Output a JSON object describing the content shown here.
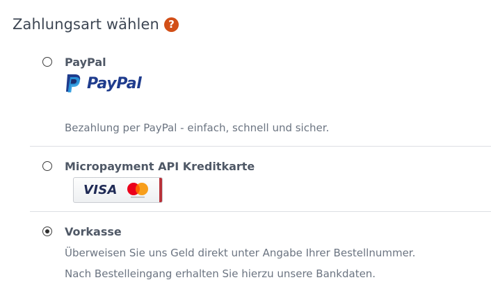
{
  "section": {
    "title": "Zahlungsart wählen",
    "help_icon": "question-circle-icon",
    "help_glyph": "?",
    "help_color": "#d24f17"
  },
  "payment_options": [
    {
      "label": "PayPal",
      "logo_text": "PayPal",
      "logo_icon": "paypal-logo-icon",
      "description": "Bezahlung per PayPal - einfach, schnell und sicher.",
      "selected": false
    },
    {
      "label": "Micropayment API Kreditkarte",
      "logo_text": "VISA",
      "logo_icon": "visa-mastercard-logo-icon",
      "selected": false
    },
    {
      "label": "Vorkasse",
      "description_lines": [
        "Überweisen Sie uns Geld direkt unter Angabe Ihrer Bestellnummer.",
        "Nach Bestelleingang erhalten Sie hierzu unsere Bankdaten."
      ],
      "selected": true
    }
  ],
  "colors": {
    "paypal_dark_blue": "#1f3c8d",
    "paypal_light_blue": "#2a9be0",
    "mastercard_red": "#eb001b",
    "mastercard_orange": "#f79e1b"
  }
}
